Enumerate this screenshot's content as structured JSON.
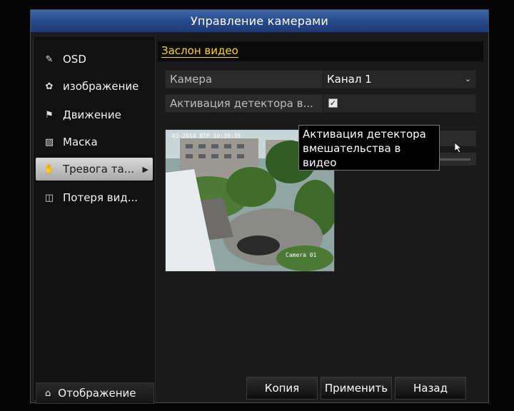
{
  "window": {
    "title": "Управление камерами"
  },
  "sidebar": {
    "items": [
      {
        "label": "OSD",
        "icon": "pen-icon"
      },
      {
        "label": "изображение",
        "icon": "palette-icon"
      },
      {
        "label": "Движение",
        "icon": "running-man-icon"
      },
      {
        "label": "Маска",
        "icon": "mask-icon"
      },
      {
        "label": "Тревога та...",
        "icon": "hand-icon",
        "active": true
      },
      {
        "label": "Потеря вид...",
        "icon": "video-loss-icon"
      }
    ],
    "display_label": "Отображение"
  },
  "main": {
    "section_title": "Заслон видео",
    "camera_label": "Камера",
    "camera_value": "Канал 1",
    "activate_label": "Активация детектора в...",
    "activate_checked": true,
    "tooltip": "Активация детектора вмешательства в видео",
    "preview": {
      "osd_date": "-03-2014 ВТР 10:39:35",
      "camera_name": "Camera 01"
    }
  },
  "buttons": {
    "copy": "Копия",
    "apply": "Применить",
    "back": "Назад"
  },
  "colors": {
    "title_bar": "#2f5597",
    "section_title": "#ffd21f",
    "active_item": "#c8c8c8"
  }
}
